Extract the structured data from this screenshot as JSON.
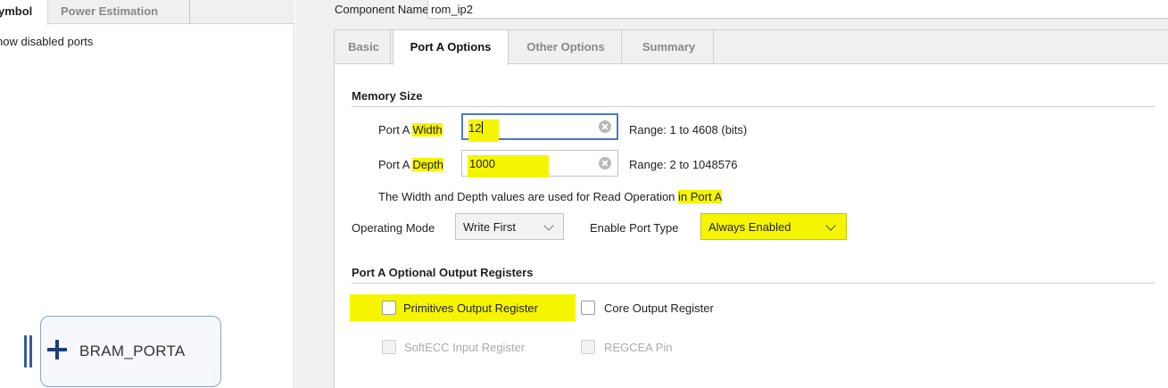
{
  "left_panel": {
    "tabs": [
      {
        "label": "ymbol"
      },
      {
        "label": "Power Estimation"
      }
    ],
    "show_disabled_ports": "how disabled ports",
    "bram_block": {
      "label": "BRAM_PORTA",
      "icon": "plus-icon"
    }
  },
  "header": {
    "component_name_label": "Component Name",
    "component_name_value": "rom_ip2"
  },
  "tabs": [
    {
      "label": "Basic"
    },
    {
      "label": "Port A Options"
    },
    {
      "label": "Other Options"
    },
    {
      "label": "Summary"
    }
  ],
  "memory_size": {
    "title": "Memory Size",
    "width": {
      "label_prefix": "Port A ",
      "label_highlight": "Width",
      "value": "12",
      "range": "Range: 1 to 4608 (bits)"
    },
    "depth": {
      "label_prefix": "Port A ",
      "label_highlight": "Depth",
      "value": "1000",
      "range": "Range: 2 to 1048576"
    },
    "note_prefix": "The Width and Depth values are used for Read Operation ",
    "note_highlight": "in Port A"
  },
  "operating_mode": {
    "label": "Operating Mode",
    "value": "Write First"
  },
  "enable_port_type": {
    "label": "Enable Port Type",
    "value": "Always Enabled"
  },
  "output_registers": {
    "title": "Port A Optional Output Registers",
    "primitives": {
      "label": "Primitives Output Register",
      "checked": false
    },
    "core": {
      "label": "Core Output Register",
      "checked": false
    },
    "softecc": {
      "label": "SoftECC Input Register",
      "checked": false,
      "disabled": true
    },
    "regcea": {
      "label": "REGCEA Pin",
      "checked": false,
      "disabled": true
    }
  },
  "colors": {
    "highlight": "#f6f500",
    "focus_border": "#4a7ac9",
    "bram_block": "#1d3f75"
  }
}
